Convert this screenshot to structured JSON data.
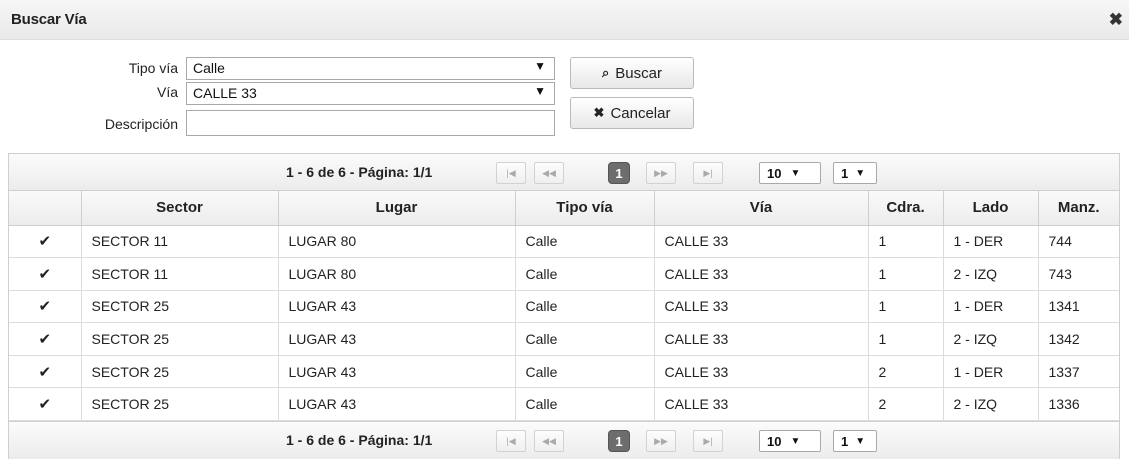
{
  "dialog": {
    "title": "Buscar Vía",
    "close_icon": "close-icon"
  },
  "form": {
    "tipo_via_label": "Tipo vía",
    "tipo_via_value": "Calle",
    "via_label": "Vía",
    "via_value": "CALLE 33",
    "descripcion_label": "Descripción",
    "descripcion_value": "",
    "buscar_label": "Buscar",
    "cancelar_label": "Cancelar"
  },
  "pager": {
    "info": "1 - 6 de 6 - Página: 1/1",
    "first": "|◀",
    "prev": "◀◀",
    "current_page": "1",
    "next": "▶▶",
    "last": "▶|",
    "page_size": "10",
    "page_select": "1"
  },
  "table": {
    "columns": [
      "",
      "Sector",
      "Lugar",
      "Tipo vía",
      "Vía",
      "Cdra.",
      "Lado",
      "Manz."
    ],
    "rows": [
      [
        "✔",
        "SECTOR 11",
        "LUGAR 80",
        "Calle",
        "CALLE 33",
        "1",
        "1 - DER",
        "744"
      ],
      [
        "✔",
        "SECTOR 11",
        "LUGAR 80",
        "Calle",
        "CALLE 33",
        "1",
        "2 - IZQ",
        "743"
      ],
      [
        "✔",
        "SECTOR 25",
        "LUGAR 43",
        "Calle",
        "CALLE 33",
        "1",
        "1 - DER",
        "1341"
      ],
      [
        "✔",
        "SECTOR 25",
        "LUGAR 43",
        "Calle",
        "CALLE 33",
        "1",
        "2 - IZQ",
        "1342"
      ],
      [
        "✔",
        "SECTOR 25",
        "LUGAR 43",
        "Calle",
        "CALLE 33",
        "2",
        "1 - DER",
        "1337"
      ],
      [
        "✔",
        "SECTOR 25",
        "LUGAR 43",
        "Calle",
        "CALLE 33",
        "2",
        "2 - IZQ",
        "1336"
      ]
    ]
  }
}
